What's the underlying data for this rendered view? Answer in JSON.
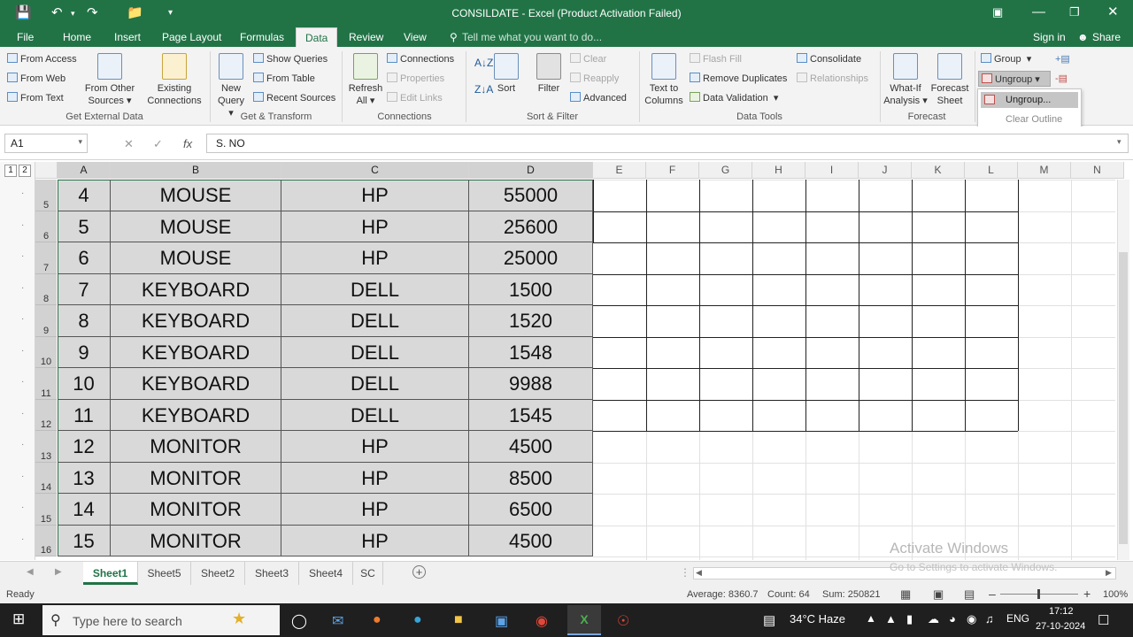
{
  "window": {
    "title": "CONSILDATE - Excel (Product Activation Failed)"
  },
  "menu": {
    "file": "File",
    "tabs": [
      "Home",
      "Insert",
      "Page Layout",
      "Formulas",
      "Data",
      "Review",
      "View"
    ],
    "active_tab": "Data",
    "tell_me": "Tell me what you want to do...",
    "sign_in": "Sign in",
    "share": "Share"
  },
  "ribbon": {
    "get_external": {
      "from_access": "From Access",
      "from_web": "From Web",
      "from_text": "From Text",
      "from_other": "From Other",
      "sources": "Sources",
      "existing": "Existing",
      "connections": "Connections",
      "label": "Get External Data"
    },
    "get_transform": {
      "new": "New",
      "query": "Query",
      "show_queries": "Show Queries",
      "from_table": "From Table",
      "recent_sources": "Recent Sources",
      "label": "Get & Transform"
    },
    "connections": {
      "refresh": "Refresh",
      "all": "All",
      "connections": "Connections",
      "properties": "Properties",
      "edit_links": "Edit Links",
      "label": "Connections"
    },
    "sort_filter": {
      "sort": "Sort",
      "filter": "Filter",
      "clear": "Clear",
      "reapply": "Reapply",
      "advanced": "Advanced",
      "label": "Sort & Filter"
    },
    "data_tools": {
      "text_to": "Text to",
      "columns": "Columns",
      "flash_fill": "Flash Fill",
      "remove_duplicates": "Remove Duplicates",
      "data_validation": "Data Validation",
      "consolidate": "Consolidate",
      "relationships": "Relationships",
      "label": "Data Tools"
    },
    "forecast": {
      "what_if": "What-If",
      "analysis": "Analysis",
      "forecast": "Forecast",
      "sheet": "Sheet",
      "label": "Forecast"
    },
    "outline": {
      "group": "Group",
      "ungroup": "Ungroup"
    }
  },
  "dropdown": {
    "ungroup_item": "Ungroup...",
    "clear_outline": "Clear Outline"
  },
  "formula_bar": {
    "name_box": "A1",
    "fx": "fx",
    "content": "S. NO"
  },
  "grid": {
    "columns": [
      "A",
      "B",
      "C",
      "D",
      "E",
      "F",
      "G",
      "H",
      "I",
      "J",
      "K",
      "L",
      "M",
      "N"
    ],
    "outline_levels": [
      "1",
      "2"
    ],
    "rows": [
      {
        "n": "5",
        "a": "4",
        "b": "MOUSE",
        "c": "HP",
        "d": "55000"
      },
      {
        "n": "6",
        "a": "5",
        "b": "MOUSE",
        "c": "HP",
        "d": "25600"
      },
      {
        "n": "7",
        "a": "6",
        "b": "MOUSE",
        "c": "HP",
        "d": "25000"
      },
      {
        "n": "8",
        "a": "7",
        "b": "KEYBOARD",
        "c": "DELL",
        "d": "1500"
      },
      {
        "n": "9",
        "a": "8",
        "b": "KEYBOARD",
        "c": "DELL",
        "d": "1520"
      },
      {
        "n": "10",
        "a": "9",
        "b": "KEYBOARD",
        "c": "DELL",
        "d": "1548"
      },
      {
        "n": "11",
        "a": "10",
        "b": "KEYBOARD",
        "c": "DELL",
        "d": "9988"
      },
      {
        "n": "12",
        "a": "11",
        "b": "KEYBOARD",
        "c": "DELL",
        "d": "1545"
      },
      {
        "n": "13",
        "a": "12",
        "b": "MONITOR",
        "c": "HP",
        "d": "4500"
      },
      {
        "n": "14",
        "a": "13",
        "b": "MONITOR",
        "c": "HP",
        "d": "8500"
      },
      {
        "n": "15",
        "a": "14",
        "b": "MONITOR",
        "c": "HP",
        "d": "6500"
      },
      {
        "n": "16",
        "a": "15",
        "b": "MONITOR",
        "c": "HP",
        "d": "4500"
      }
    ]
  },
  "sheets": {
    "tabs": [
      "Sheet1",
      "Sheet5",
      "Sheet2",
      "Sheet3",
      "Sheet4",
      "SC"
    ],
    "active": "Sheet1"
  },
  "status": {
    "ready": "Ready",
    "average": "Average: 8360.7",
    "count": "Count: 64",
    "sum": "Sum: 250821",
    "zoom": "100%"
  },
  "watermark": {
    "line1": "Activate Windows",
    "line2": "Go to Settings to activate Windows."
  },
  "taskbar": {
    "search_placeholder": "Type here to search",
    "weather": "34°C  Haze",
    "lang": "ENG",
    "time": "17:12",
    "date": "27-10-2024"
  },
  "colors": {
    "excel_green": "#217346",
    "selection": "#d9d9d9",
    "taskbar": "#1f1f1f"
  }
}
